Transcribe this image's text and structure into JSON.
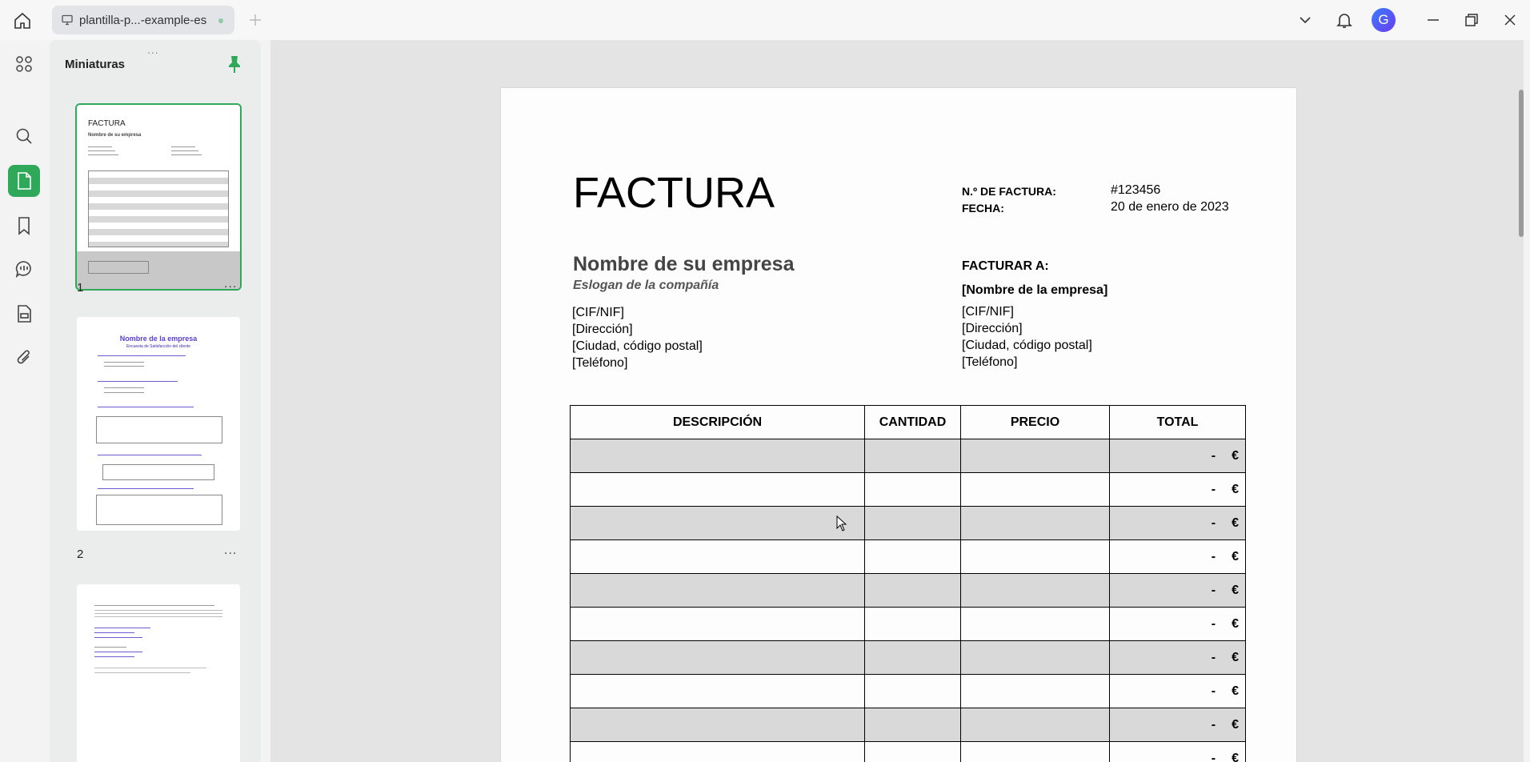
{
  "tab": {
    "title": "plantilla-p...-example-es"
  },
  "sidebar": {
    "title": "Miniaturas",
    "grip": "...",
    "thumbnails": [
      {
        "number": "1",
        "more": "..."
      },
      {
        "number": "2",
        "more": "..."
      }
    ]
  },
  "thumb1": {
    "title": "FACTURA",
    "company": "Nombre de su empresa"
  },
  "thumb2": {
    "title": "Nombre de la empresa",
    "subtitle": "Encuesta de Satisfacción del cliente"
  },
  "invoice": {
    "title": "FACTURA",
    "number_label": "N.º DE FACTURA:",
    "number_value": "#123456",
    "date_label": "FECHA:",
    "date_value": "20 de enero de 2023",
    "company": "Nombre de su empresa",
    "slogan": "Eslogan de la compañía",
    "sender": [
      "[CIF/NIF]",
      "[Dirección]",
      "[Ciudad, código postal]",
      "[Teléfono]"
    ],
    "billto_label": "FACTURAR A:",
    "billto_name": "[Nombre de la empresa]",
    "billto": [
      "[CIF/NIF]",
      "[Dirección]",
      "[Ciudad, código postal]",
      "[Teléfono]"
    ],
    "columns": [
      "DESCRIPCIÓN",
      "CANTIDAD",
      "PRECIO",
      "TOTAL"
    ],
    "row_dash": "-",
    "row_currency": "€"
  },
  "colors": {
    "accent": "#2fa85a",
    "row_shade": "#d9d9d9"
  }
}
